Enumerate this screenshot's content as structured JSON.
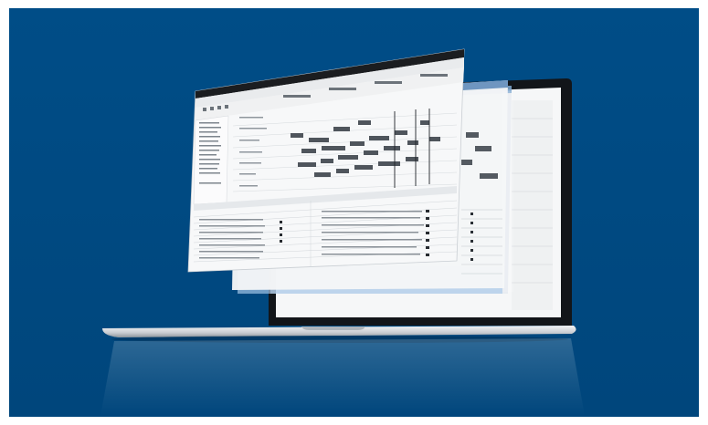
{
  "colors": {
    "background": "#004d87",
    "frame": "#ffffff",
    "laptop_body": "#cfd3d8",
    "laptop_bezel": "#111418",
    "window_bg": "#f4f5f6",
    "window_titlebar": "#1a1a1a",
    "gantt_bar": "#555b62",
    "selection_blue": "#bcd6ee"
  },
  "icons": [
    "laptop-icon",
    "software-window-stack"
  ]
}
